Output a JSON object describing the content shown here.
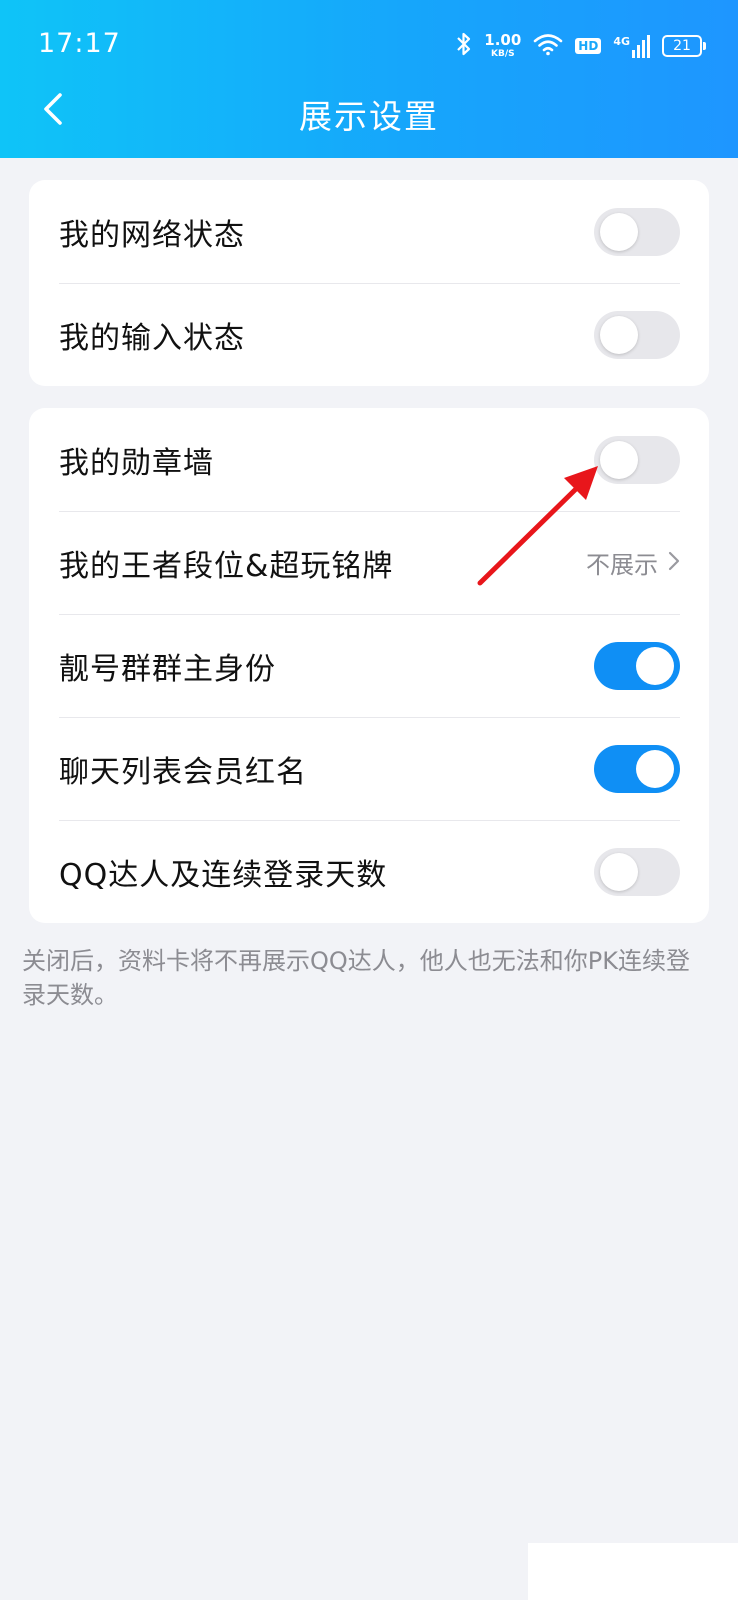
{
  "status_bar": {
    "time": "17:17",
    "net_speed_value": "1.00",
    "net_speed_unit": "KB/S",
    "hd_badge": "HD",
    "signal_label": "4G",
    "battery": "21"
  },
  "nav": {
    "title": "展示设置"
  },
  "settings_group_1": [
    {
      "label": "我的网络状态",
      "toggle_on": false
    },
    {
      "label": "我的输入状态",
      "toggle_on": false
    }
  ],
  "settings_group_2": {
    "medal_wall": {
      "label": "我的勋章墙",
      "toggle_on": false
    },
    "honor_of_kings": {
      "label": "我的王者段位&超玩铭牌",
      "value": "不展示"
    },
    "group_owner": {
      "label": "靓号群群主身份",
      "toggle_on": true
    },
    "vip_red_name": {
      "label": "聊天列表会员红名",
      "toggle_on": true
    },
    "qq_master": {
      "label": "QQ达人及连续登录天数",
      "toggle_on": false
    }
  },
  "footnote": "关闭后，资料卡将不再展示QQ达人，他人也无法和你PK连续登录天数。",
  "colors": {
    "header_start": "#0fc4f8",
    "header_end": "#1e96ff",
    "toggle_on": "#0f8ff5",
    "toggle_off": "#e7e7eb",
    "annotation_arrow": "#e8161b"
  },
  "annotation": "red-arrow pointing at medal wall toggle"
}
